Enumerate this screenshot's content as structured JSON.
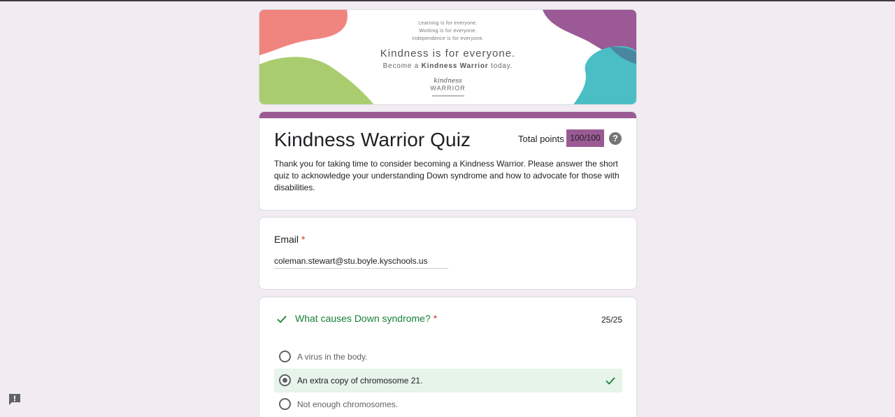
{
  "banner": {
    "line1": "Learning is for everyone.",
    "line2": "Working is for everyone.",
    "line3": "Independence is for everyone.",
    "headline": "Kindness is for everyone.",
    "sub_prefix": "Become a ",
    "sub_bold": "Kindness Warrior",
    "sub_suffix": " today.",
    "logo_script": "kindness",
    "logo_word": "WARRIOR",
    "colors": {
      "coral": "#f0857f",
      "green": "#a9cd6e",
      "purple": "#9b5a96",
      "teal": "#4bbdc4"
    }
  },
  "form": {
    "title": "Kindness Warrior Quiz",
    "points_label": "Total points",
    "points_value": "100/100",
    "description": "Thank you for taking time to consider becoming a Kindness Warrior. Please answer the short quiz to acknowledge your understanding Down syndrome and how to advocate for those with disabilities.",
    "accent_color": "#9a5b94"
  },
  "email": {
    "label": "Email",
    "required_mark": "*",
    "value": "coleman.stewart@stu.boyle.kyschools.us"
  },
  "question1": {
    "title": "What causes Down syndrome?",
    "required_mark": "*",
    "score": "25/25",
    "status_color": "#188038",
    "options": [
      {
        "label": "A virus in the body.",
        "selected": false,
        "correct": false
      },
      {
        "label": "An extra copy of chromosome 21.",
        "selected": true,
        "correct": true
      },
      {
        "label": "Not enough chromosomes.",
        "selected": false,
        "correct": false
      }
    ]
  }
}
